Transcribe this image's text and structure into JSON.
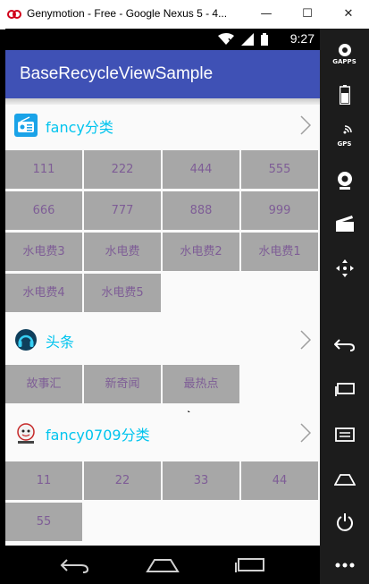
{
  "window": {
    "title": "Genymotion - Free - Google Nexus 5 - 4...",
    "minimize": "—",
    "maximize": "☐",
    "close": "✕"
  },
  "statusbar": {
    "time": "9:27"
  },
  "appbar": {
    "title": "BaseRecycleViewSample"
  },
  "colors": {
    "primary": "#3f51b5",
    "section_title": "#00c4ee",
    "cell_bg": "#a7a7a7",
    "cell_text": "#7e5d96"
  },
  "sections": [
    {
      "title": "fancy分类",
      "icon": "radio-icon",
      "items": [
        "111",
        "222",
        "444",
        "555",
        "666",
        "777",
        "888",
        "999",
        "水电费3",
        "水电费",
        "水电费2",
        "水电费1",
        "水电费4",
        "水电费5"
      ]
    },
    {
      "title": "头条",
      "icon": "headphones-icon",
      "items": [
        "故事汇",
        "新奇闻",
        "最热点"
      ]
    },
    {
      "title": "fancy0709分类",
      "icon": "avatar-icon",
      "items": [
        "11",
        "22",
        "33",
        "44",
        "55"
      ]
    }
  ],
  "toolbar": {
    "gapps_label": "GAPPS",
    "gps_label": "GPS"
  }
}
